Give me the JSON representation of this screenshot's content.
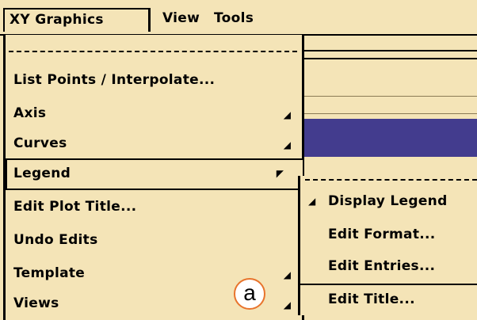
{
  "menubar": {
    "items": [
      {
        "label": "XY Graphics"
      },
      {
        "label": "View"
      },
      {
        "label": "Tools"
      }
    ]
  },
  "dropdown": {
    "items": [
      {
        "label": "List Points / Interpolate...",
        "has_submenu": false
      },
      {
        "label": "Axis",
        "has_submenu": true
      },
      {
        "label": "Curves",
        "has_submenu": true
      },
      {
        "label": "Legend",
        "has_submenu": true,
        "highlighted": true
      },
      {
        "label": "Edit Plot Title...",
        "has_submenu": false
      },
      {
        "label": "Undo Edits",
        "has_submenu": false
      },
      {
        "label": "Template",
        "has_submenu": true
      },
      {
        "label": "Views",
        "has_submenu": true
      }
    ]
  },
  "submenu": {
    "items": [
      {
        "label": "Display Legend",
        "checked": true
      },
      {
        "label": "Edit Format..."
      },
      {
        "label": "Edit Entries..."
      },
      {
        "label": "Edit Title...",
        "highlighted": true
      }
    ]
  },
  "annotation": {
    "label": "a"
  },
  "colors": {
    "menu_bg": "#f4e4b7",
    "selection_blue": "#433c8e",
    "annotation_ring": "#e8742c"
  },
  "icons": {
    "cascade": "cascade-arrow-icon",
    "check": "check-mark-icon"
  }
}
